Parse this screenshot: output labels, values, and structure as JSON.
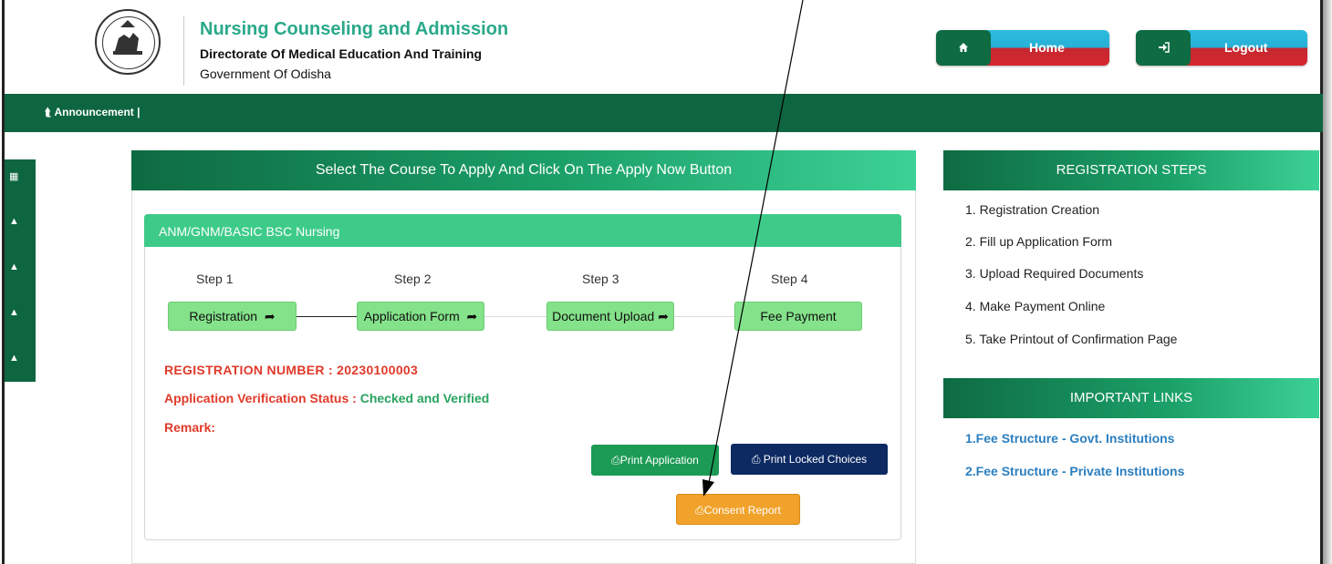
{
  "header": {
    "title": "Nursing Counseling and Admission",
    "subtitle": "Directorate Of Medical Education And Training",
    "government": "Government Of Odisha",
    "logo_icon": "odisha-emblem-icon",
    "home_label": "Home",
    "home_icon": "home-icon",
    "logout_label": "Logout",
    "logout_icon": "sign-in-icon"
  },
  "announcement": {
    "label": "Announcement  |",
    "icon": "bullhorn-icon"
  },
  "sidebar_icons": [
    "grid-icon",
    "bell-icon",
    "bell-icon",
    "bell-icon",
    "bell-icon"
  ],
  "main": {
    "heading": "Select The Course To Apply And Click On The Apply Now Button",
    "course": "ANM/GNM/BASIC BSC Nursing",
    "steps": [
      {
        "label": "Step 1",
        "button": "Registration",
        "icon": "share-icon"
      },
      {
        "label": "Step 2",
        "button": "Application Form",
        "icon": "share-icon"
      },
      {
        "label": "Step 3",
        "button": "Document Upload",
        "icon": "share-icon"
      },
      {
        "label": "Step 4",
        "button": "Fee Payment",
        "icon": ""
      }
    ],
    "registration_label": "REGISTRATION NUMBER : ",
    "registration_number": "20230100003",
    "status_label": "Application Verification Status : ",
    "status_value": "Checked and Verified",
    "remark_label": "Remark:",
    "print_application": "Print Application",
    "print_locked": "Print Locked Choices",
    "consent_report": "Consent Report",
    "print_icon": "print-icon"
  },
  "right": {
    "registration_steps_title": "REGISTRATION STEPS",
    "steps": [
      "1. Registration Creation",
      "2. Fill up Application Form",
      "3. Upload Required Documents",
      "4. Make Payment Online",
      "5. Take Printout of Confirmation Page"
    ],
    "links_title": "IMPORTANT LINKS",
    "links": [
      "1.Fee Structure - Govt. Institutions",
      "2.Fee Structure - Private Institutions"
    ]
  },
  "colors": {
    "brand_green": "#0e6640",
    "title_teal": "#2aa98a",
    "registration_red": "#e03a2a",
    "verified_green": "#28a35f",
    "consent_orange": "#f1a22b",
    "link_blue": "#2c7fbf"
  }
}
